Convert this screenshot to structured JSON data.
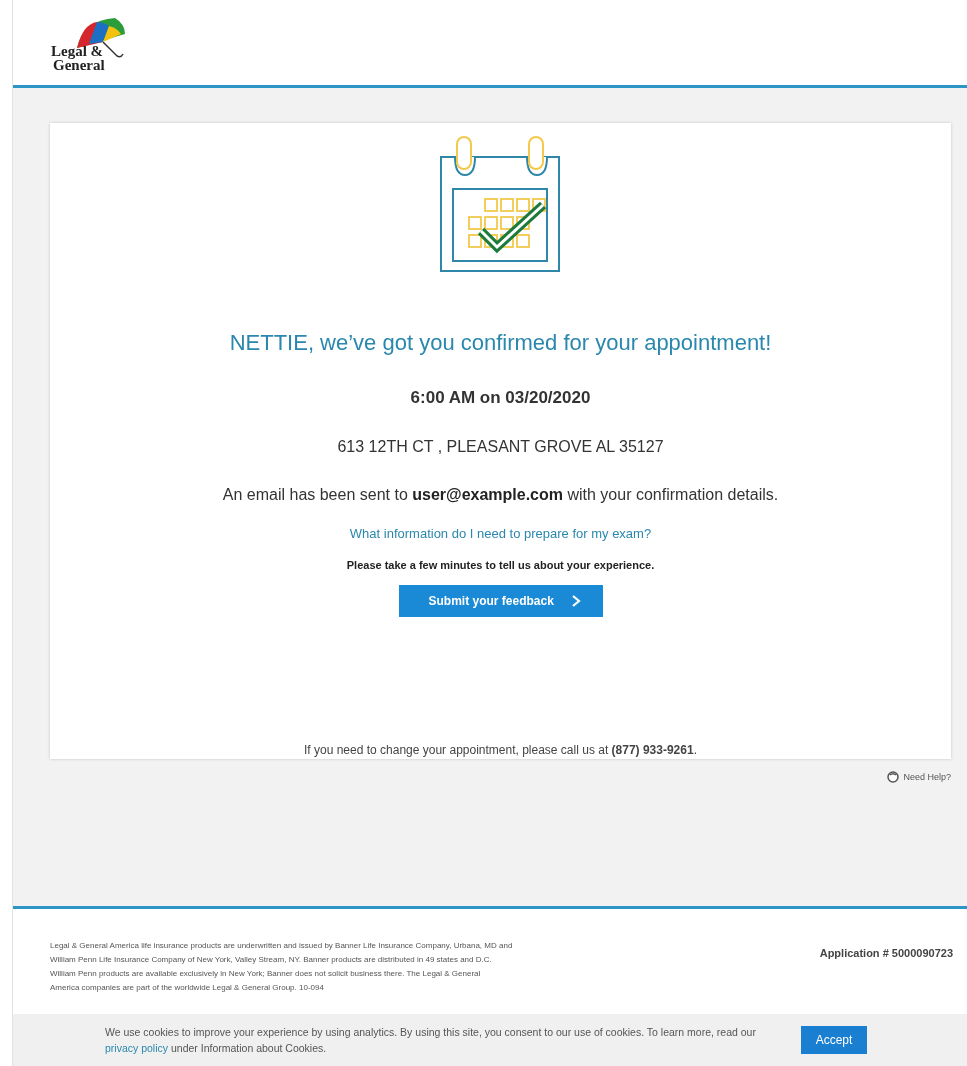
{
  "header": {
    "logo_lines": [
      "Legal &",
      "General"
    ]
  },
  "confirmation": {
    "heading": "NETTIE, we’ve got you confirmed for your appointment!",
    "datetime": "6:00 AM on 03/20/2020",
    "address": "613 12TH CT , PLEASANT GROVE AL 35127",
    "email_note": "An email has been sent to **user@example.com** with your confirmation details.",
    "prepare_link": "What information do I need to prepare for my exam?",
    "feedback_prompt": "Please take a few minutes to tell us about your experience.",
    "feedback_button": "Submit your feedback",
    "change_note": "If you need to change your appointment, please call us at **(877) 933-9261**."
  },
  "help_link": "Need Help?",
  "footer": {
    "disclaimer_lines": [
      "Legal & General America life insurance products are underwritten and issued by Banner Life Insurance Company, Urbana, MD and",
      "William Penn Life Insurance Company of New York, Valley Stream, NY. Banner products are distributed in 49 states and D.C.",
      "William Penn products are available exclusively in New York; Banner does not solicit business there. The Legal & General",
      "America companies are part of the worldwide Legal & General Group. 10-094"
    ],
    "application": "Application # 5000090723"
  },
  "cookie_bar": {
    "text_before": "We use cookies to improve your experience by using analytics. By using this site, you consent to our use of cookies. To learn more, read our",
    "link": "privacy policy",
    "text_after": "under Information about Cookies.",
    "button": "Accept"
  }
}
